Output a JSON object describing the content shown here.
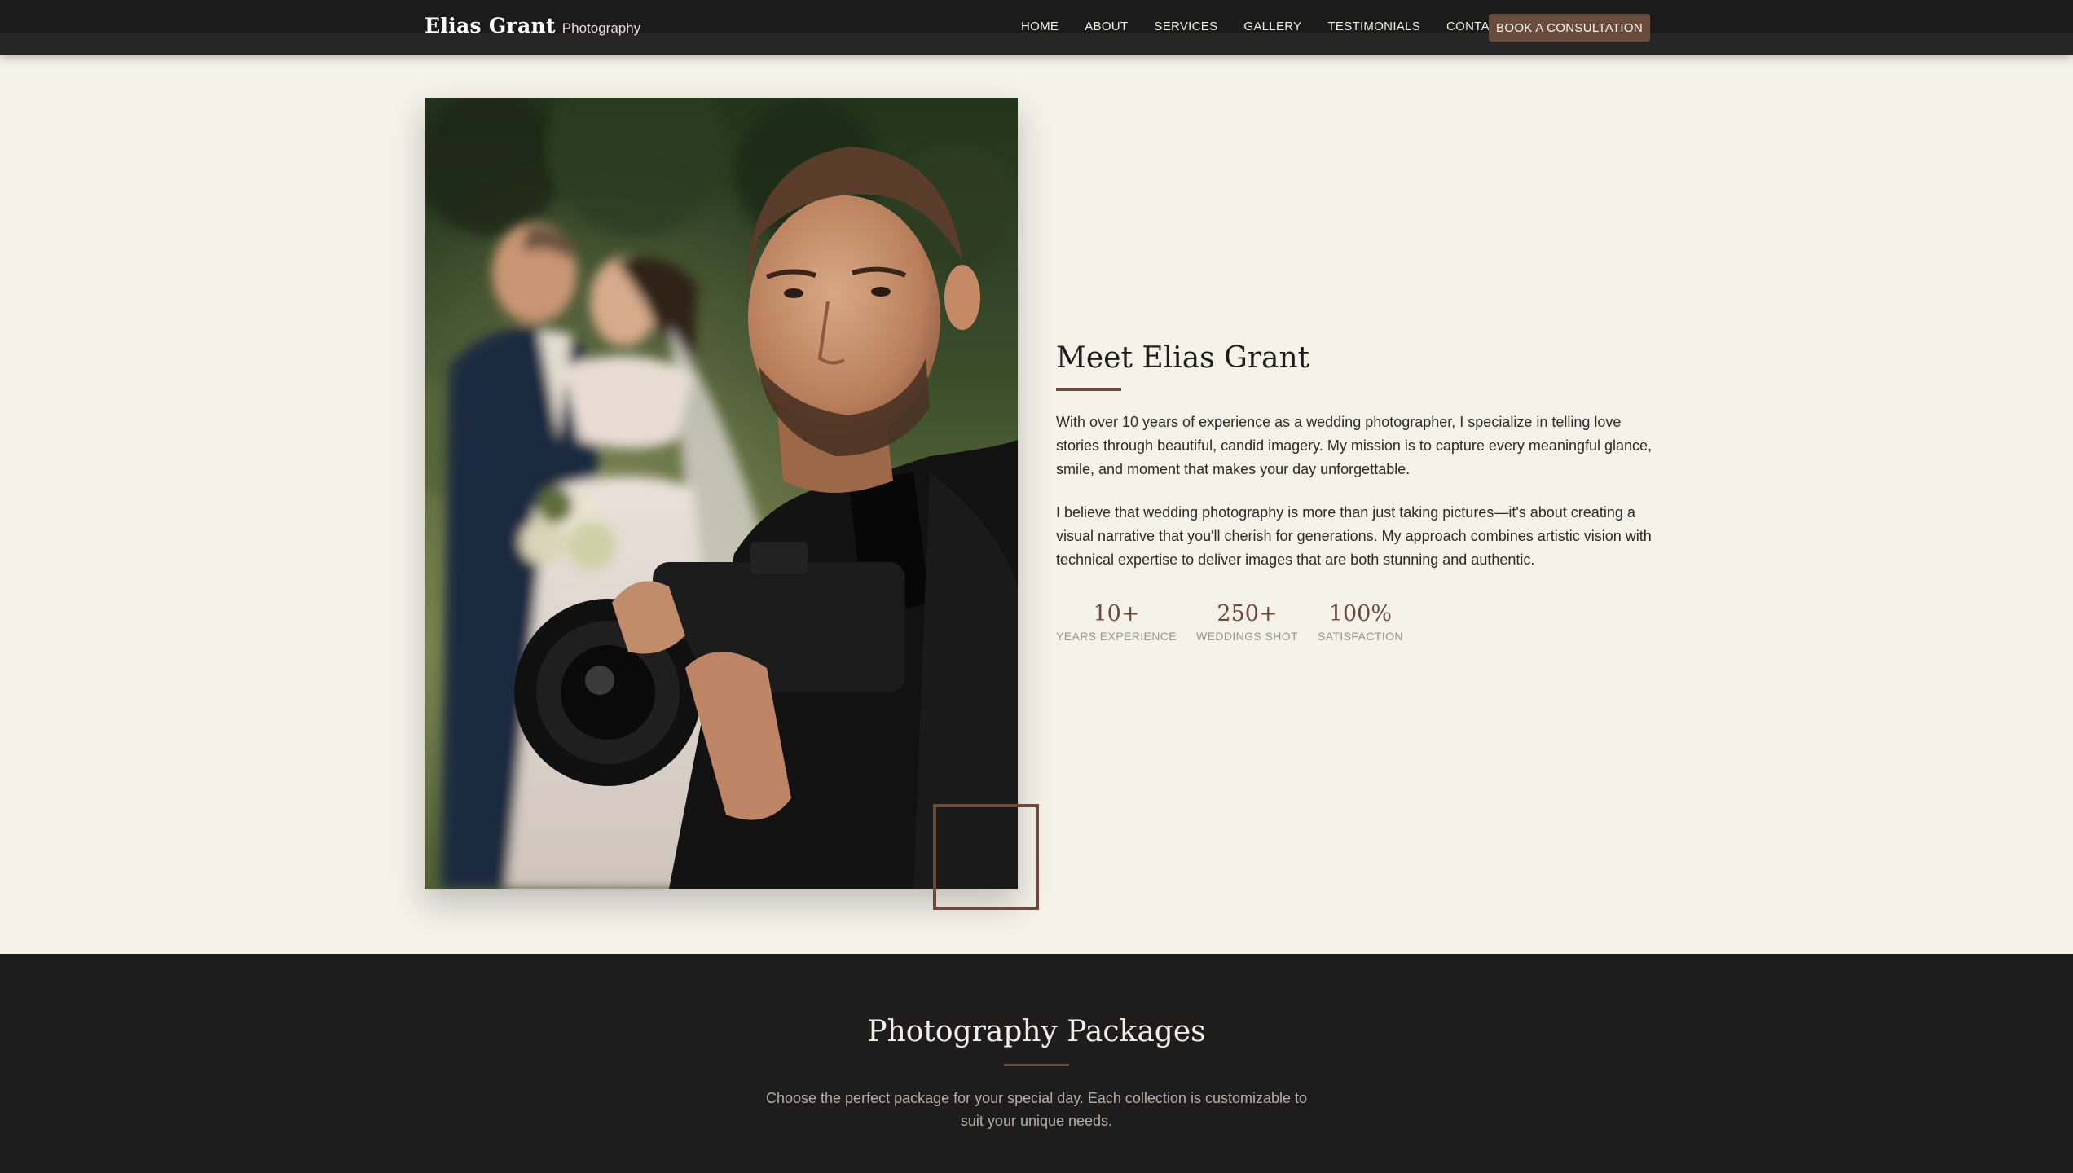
{
  "header": {
    "brand_name": "Elias Grant",
    "brand_sub": "Photography",
    "nav": [
      "HOME",
      "ABOUT",
      "SERVICES",
      "GALLERY",
      "TESTIMONIALS",
      "CONTACT"
    ],
    "cta": "BOOK A CONSULTATION"
  },
  "about": {
    "title": "Meet Elias Grant",
    "paragraphs": [
      "With over 10 years of experience as a wedding photographer, I specialize in telling love stories through beautiful, candid imagery. My mission is to capture every meaningful glance, smile, and moment that makes your day unforgettable.",
      "I believe that wedding photography is more than just taking pictures—it's about creating a visual narrative that you'll cherish for generations. My approach combines artistic vision with technical expertise to deliver images that are both stunning and authentic."
    ],
    "stats": [
      {
        "value": "10+",
        "label": "YEARS EXPERIENCE"
      },
      {
        "value": "250+",
        "label": "WEDDINGS SHOT"
      },
      {
        "value": "100%",
        "label": "SATISFACTION"
      }
    ]
  },
  "packages": {
    "title": "Photography Packages",
    "subtitle": "Choose the perfect package for your special day. Each collection is customizable to suit your unique needs."
  },
  "colors": {
    "accent": "#6b4a3c",
    "header_bg": "#1b1b1b",
    "page_bg": "#f5f2ea",
    "packages_bg": "#1d1d1d"
  }
}
